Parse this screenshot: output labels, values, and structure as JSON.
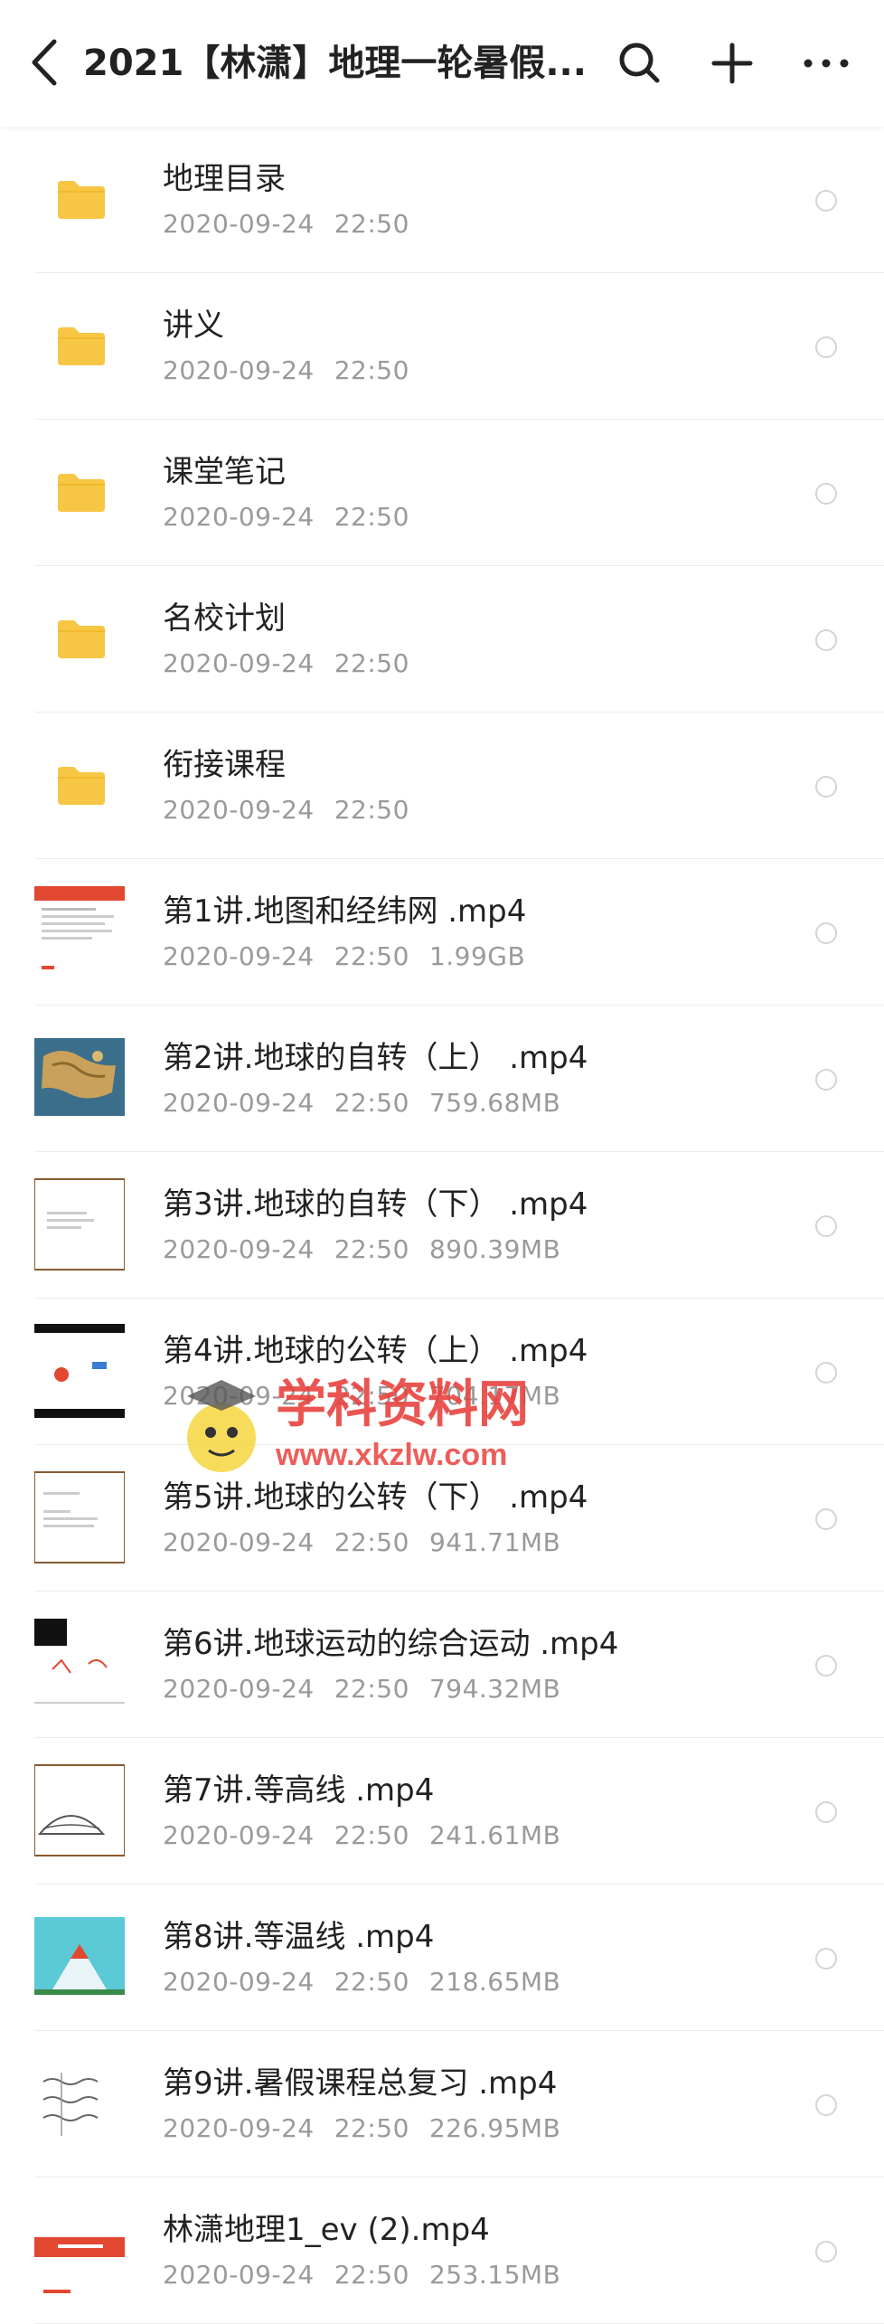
{
  "header": {
    "title": "2021【林潇】地理一轮暑假...",
    "back_icon": "chevron-left-icon",
    "search_icon": "search-icon",
    "add_icon": "plus-icon",
    "more_icon": "more-horizontal-icon"
  },
  "colors": {
    "folder": "#F6C644",
    "text": "#222222",
    "meta": "#9A9A9A",
    "divider": "#ECECEC",
    "watermark_red": "#E9433F",
    "watermark_green": "#3FBF4A"
  },
  "files": [
    {
      "name": "地理目录",
      "date": "2020-09-24",
      "time": "22:50",
      "size": "",
      "type": "folder"
    },
    {
      "name": "讲义",
      "date": "2020-09-24",
      "time": "22:50",
      "size": "",
      "type": "folder"
    },
    {
      "name": "课堂笔记",
      "date": "2020-09-24",
      "time": "22:50",
      "size": "",
      "type": "folder"
    },
    {
      "name": "名校计划",
      "date": "2020-09-24",
      "time": "22:50",
      "size": "",
      "type": "folder"
    },
    {
      "name": "衔接课程",
      "date": "2020-09-24",
      "time": "22:50",
      "size": "",
      "type": "folder"
    },
    {
      "name": "第1讲.地图和经纬网 .mp4",
      "date": "2020-09-24",
      "time": "22:50",
      "size": "1.99GB",
      "type": "video",
      "thumb": "t1"
    },
    {
      "name": "第2讲.地球的自转（上） .mp4",
      "date": "2020-09-24",
      "time": "22:50",
      "size": "759.68MB",
      "type": "video",
      "thumb": "t2"
    },
    {
      "name": "第3讲.地球的自转（下） .mp4",
      "date": "2020-09-24",
      "time": "22:50",
      "size": "890.39MB",
      "type": "video",
      "thumb": "t3"
    },
    {
      "name": "第4讲.地球的公转（上） .mp4",
      "date": "2020-09-24",
      "time": "22:50",
      "size": "704.17MB",
      "type": "video",
      "thumb": "t4"
    },
    {
      "name": "第5讲.地球的公转（下） .mp4",
      "date": "2020-09-24",
      "time": "22:50",
      "size": "941.71MB",
      "type": "video",
      "thumb": "t5"
    },
    {
      "name": "第6讲.地球运动的综合运动 .mp4",
      "date": "2020-09-24",
      "time": "22:50",
      "size": "794.32MB",
      "type": "video",
      "thumb": "t6"
    },
    {
      "name": "第7讲.等高线 .mp4",
      "date": "2020-09-24",
      "time": "22:50",
      "size": "241.61MB",
      "type": "video",
      "thumb": "t7"
    },
    {
      "name": "第8讲.等温线 .mp4",
      "date": "2020-09-24",
      "time": "22:50",
      "size": "218.65MB",
      "type": "video",
      "thumb": "t8"
    },
    {
      "name": "第9讲.暑假课程总复习 .mp4",
      "date": "2020-09-24",
      "time": "22:50",
      "size": "226.95MB",
      "type": "video",
      "thumb": "t9"
    },
    {
      "name": "林潇地理1_ev (2).mp4",
      "date": "2020-09-24",
      "time": "22:50",
      "size": "253.15MB",
      "type": "video",
      "thumb": "t10"
    }
  ],
  "watermark": {
    "brand": "学科资料网",
    "url": "www.xkzlw.com"
  }
}
